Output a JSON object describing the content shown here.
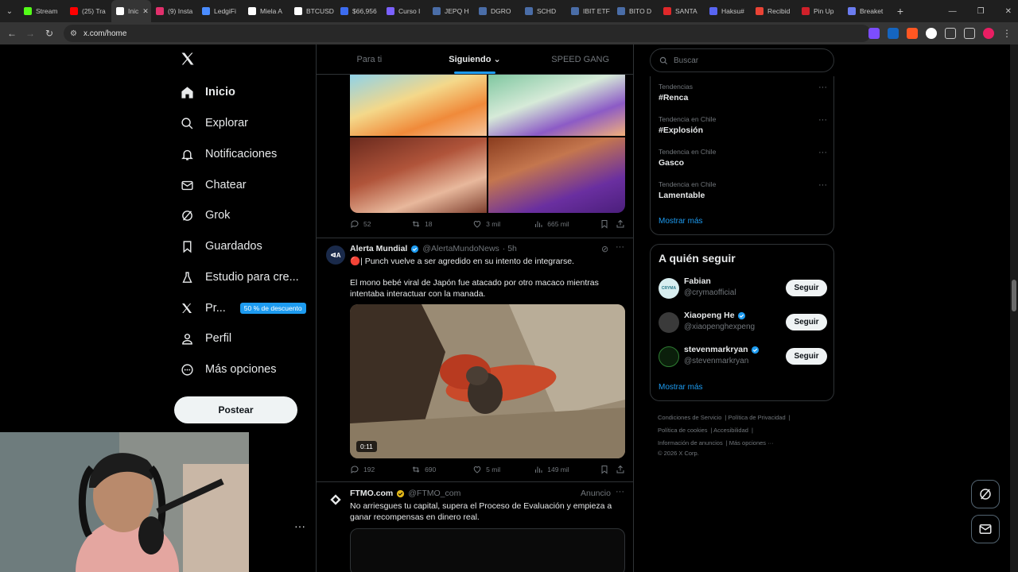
{
  "browser": {
    "tabs": [
      {
        "label": "Stream",
        "color": "#53fc18"
      },
      {
        "label": "(25) Tra",
        "color": "#ff0000"
      },
      {
        "label": "Inic",
        "color": "#ffffff",
        "active": true
      },
      {
        "label": "(9) Insta",
        "color": "#e1306c"
      },
      {
        "label": "LedgiFi",
        "color": "#4a8cff"
      },
      {
        "label": "Miela A",
        "color": "#ffffff"
      },
      {
        "label": "BTCUSD",
        "color": "#ffffff"
      },
      {
        "label": "$66,956",
        "color": "#3c6cf0"
      },
      {
        "label": "Curso I",
        "color": "#7b61ff"
      },
      {
        "label": "JEPQ H",
        "color": "#4a6da7"
      },
      {
        "label": "DGRO",
        "color": "#4a6da7"
      },
      {
        "label": "SCHD",
        "color": "#4a6da7"
      },
      {
        "label": "IBIT ETF",
        "color": "#4a6da7"
      },
      {
        "label": "BITO D",
        "color": "#4a6da7"
      },
      {
        "label": "SANTA",
        "color": "#e0282a"
      },
      {
        "label": "Haksu#",
        "color": "#5865f2"
      },
      {
        "label": "Recibid",
        "color": "#ea4335"
      },
      {
        "label": "Pin Up",
        "color": "#d0202a"
      },
      {
        "label": "Breaket",
        "color": "#6b7cf0"
      }
    ],
    "url": "x.com/home"
  },
  "nav": {
    "items": [
      {
        "label": "Inicio"
      },
      {
        "label": "Explorar"
      },
      {
        "label": "Notificaciones"
      },
      {
        "label": "Chatear"
      },
      {
        "label": "Grok"
      },
      {
        "label": "Guardados"
      },
      {
        "label": "Estudio para cre..."
      },
      {
        "label": "Pr..."
      },
      {
        "label": "Perfil"
      },
      {
        "label": "Más opciones"
      }
    ],
    "promo_badge": "50 % de descuento",
    "post_button": "Postear"
  },
  "timeline": {
    "tabs": [
      "Para ti",
      "Siguiendo",
      "SPEED GANG"
    ],
    "tweet1_actions": {
      "replies": "52",
      "reposts": "18",
      "likes": "3 mil",
      "views": "665 mil"
    },
    "tweet2": {
      "name": "Alerta Mundial",
      "handle": "@AlertaMundoNews",
      "time": "· 5h",
      "line1": "🔴| Punch vuelve a ser agredido en su intento de integrarse.",
      "line2": "El mono bebé viral de Japón fue atacado por otro macaco mientras intentaba interactuar con la manada.",
      "video_time": "0:11",
      "actions": {
        "replies": "192",
        "reposts": "690",
        "likes": "5 mil",
        "views": "149 mil"
      }
    },
    "tweet3": {
      "name": "FTMO.com",
      "handle": "@FTMO_com",
      "ad_label": "Anuncio",
      "text": "No arriesgues tu capital, supera el Proceso de Evaluación y empieza a ganar recompensas en dinero real."
    }
  },
  "sidebar": {
    "search_placeholder": "Buscar",
    "trends": [
      {
        "context": "Tendencias",
        "title": "#Renca"
      },
      {
        "context": "Tendencia en Chile",
        "title": "#Explosión"
      },
      {
        "context": "Tendencia en Chile",
        "title": "Gasco"
      },
      {
        "context": "Tendencia en Chile",
        "title": "Lamentable"
      }
    ],
    "trends_more": "Mostrar más",
    "who_to_follow_title": "A quién seguir",
    "follow": [
      {
        "name": "Fabian",
        "handle": "@crymaofficial",
        "verified": false,
        "button": "Seguir",
        "avatar_text": "CRYMA"
      },
      {
        "name": "Xiaopeng He",
        "handle": "@xiaopenghexpeng",
        "verified": true,
        "button": "Seguir"
      },
      {
        "name": "stevenmarkryan",
        "handle": "@stevenmarkryan",
        "verified": true,
        "button": "Seguir"
      }
    ],
    "follow_more": "Mostrar más",
    "footer": {
      "links": [
        "Condiciones de Servicio",
        "Política de Privacidad",
        "Política de cookies",
        "Accesibilidad",
        "Información de anuncios",
        "Más opciones ···"
      ],
      "copyright": "© 2026 X Corp."
    }
  },
  "colors": {
    "accent": "#1d9bf0",
    "verified_blue": "#1d9bf0",
    "verified_gold": "#e2b719"
  }
}
